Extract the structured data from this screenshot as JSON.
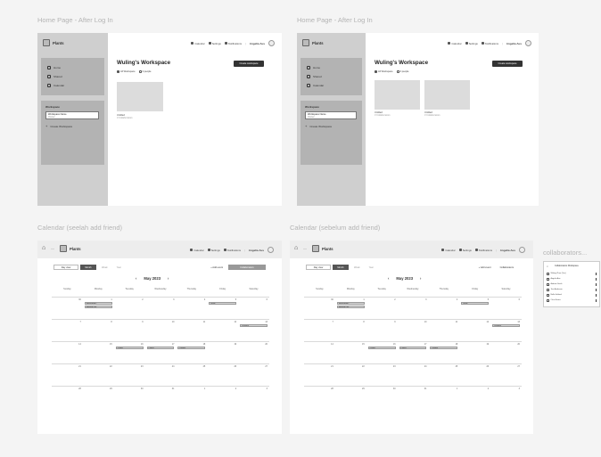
{
  "frames": {
    "home1_title": "Home Page - After Log In",
    "home2_title": "Home Page - After Log In",
    "cal1_title": "Calendar (seelah add friend)",
    "cal2_title": "Calendar (sebelum add friend)",
    "collab_title": "collaborators..."
  },
  "app": {
    "logo": "Plants",
    "nav": [
      "Calendar",
      "Settings",
      "Notifications"
    ],
    "user": "Angelia Aus"
  },
  "sidebar": {
    "items": [
      "Home",
      "Shared",
      "Calendar"
    ],
    "section": "Workspace",
    "selected_ws": "Workspace Name",
    "selected_sub": "Owner",
    "add": "Create Workspace"
  },
  "workspace": {
    "title": "Wuling's Workspace",
    "meta_a": "All Workspace",
    "meta_b": "3 people",
    "create_btn": "Create workspace",
    "cards1": [
      {
        "name": "Untitled",
        "sub": "3 Collaborators"
      }
    ],
    "cards2": [
      {
        "name": "Untitled",
        "sub": "3 Collaborators"
      },
      {
        "name": "Untitled",
        "sub": "3 Collaborators"
      }
    ]
  },
  "calendar": {
    "toolbar": [
      "Day view",
      "Month",
      "Week",
      "Year"
    ],
    "add_btn": "+ Add event",
    "share_btn": "Collaborators",
    "month": "May 2023",
    "prev": "‹",
    "next": "›",
    "home": "⌂",
    "sep": "—",
    "dows": [
      "Sunday",
      "Monday",
      "Tuesday",
      "Wednesday",
      "Thursday",
      "Friday",
      "Saturday"
    ],
    "days": [
      [
        30,
        1,
        2,
        3,
        4,
        5,
        6
      ],
      [
        7,
        8,
        9,
        10,
        11,
        12,
        13
      ],
      [
        14,
        15,
        16,
        17,
        18,
        19,
        20
      ],
      [
        21,
        22,
        23,
        24,
        25,
        26,
        27
      ],
      [
        28,
        29,
        30,
        31,
        1,
        2,
        3
      ]
    ],
    "events": [
      {
        "row": 0,
        "col": 1,
        "label": "Meeting ABC"
      },
      {
        "row": 0,
        "col": 1,
        "label": "Meeting DEF"
      },
      {
        "row": 0,
        "col": 5,
        "label": "Study"
      },
      {
        "row": 1,
        "col": 6,
        "label": "Deadline"
      },
      {
        "row": 2,
        "col": 2,
        "label": "Project"
      },
      {
        "row": 2,
        "col": 3,
        "label": "Project"
      },
      {
        "row": 2,
        "col": 4,
        "label": "Review"
      }
    ]
  },
  "collab": {
    "header": "Collaborators Workspace",
    "rows": [
      "Wuling Zhen (You)",
      "Angelia Aus",
      "Andrew Smith",
      "Tom Anderson",
      "Bella Holland",
      "Chris Evans"
    ]
  }
}
